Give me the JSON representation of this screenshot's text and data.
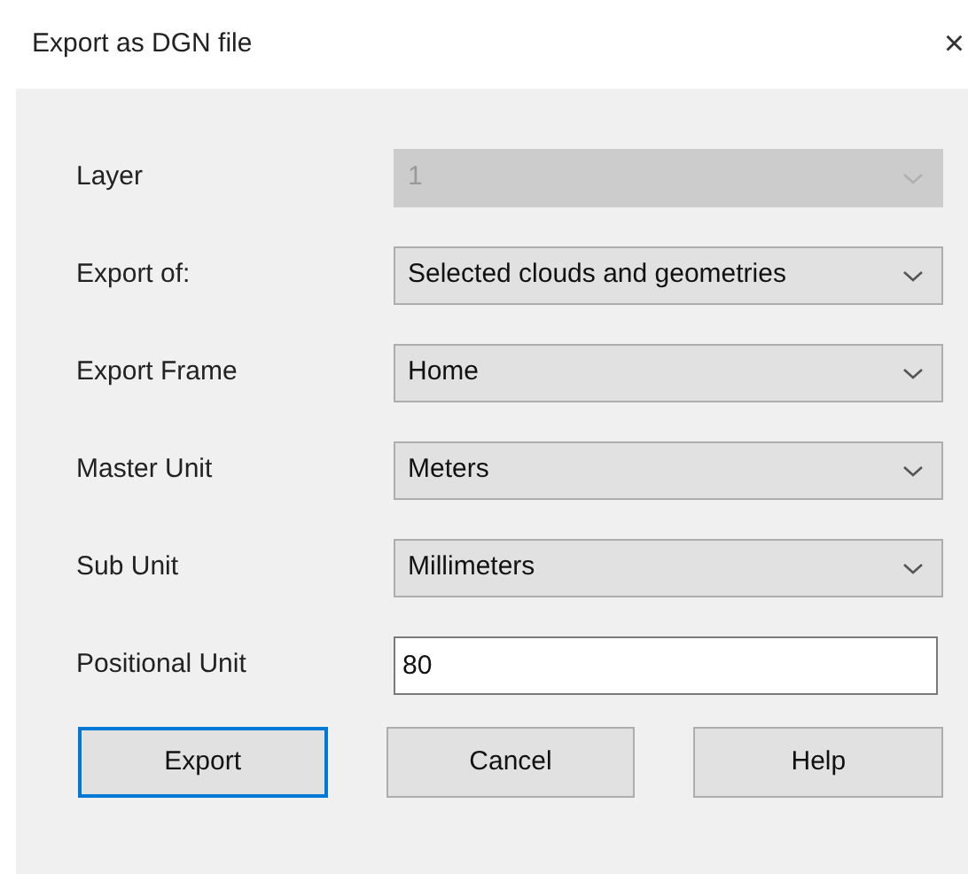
{
  "window": {
    "title": "Export as DGN file",
    "close": "×"
  },
  "fields": [
    {
      "label": "Layer",
      "kind": "dropdown",
      "value": "1",
      "disabled": true
    },
    {
      "label": "Export of:",
      "kind": "dropdown",
      "value": "Selected clouds and geometries",
      "disabled": false
    },
    {
      "label": "Export Frame",
      "kind": "dropdown",
      "value": "Home",
      "disabled": false
    },
    {
      "label": "Master Unit",
      "kind": "dropdown",
      "value": "Meters",
      "disabled": false
    },
    {
      "label": "Sub Unit",
      "kind": "dropdown",
      "value": "Millimeters",
      "disabled": false
    },
    {
      "label": "Positional Unit",
      "kind": "text",
      "value": "80",
      "disabled": false
    }
  ],
  "buttons": [
    {
      "label": "Export",
      "focused": true
    },
    {
      "label": "Cancel",
      "focused": false
    },
    {
      "label": "Help",
      "focused": false
    }
  ]
}
